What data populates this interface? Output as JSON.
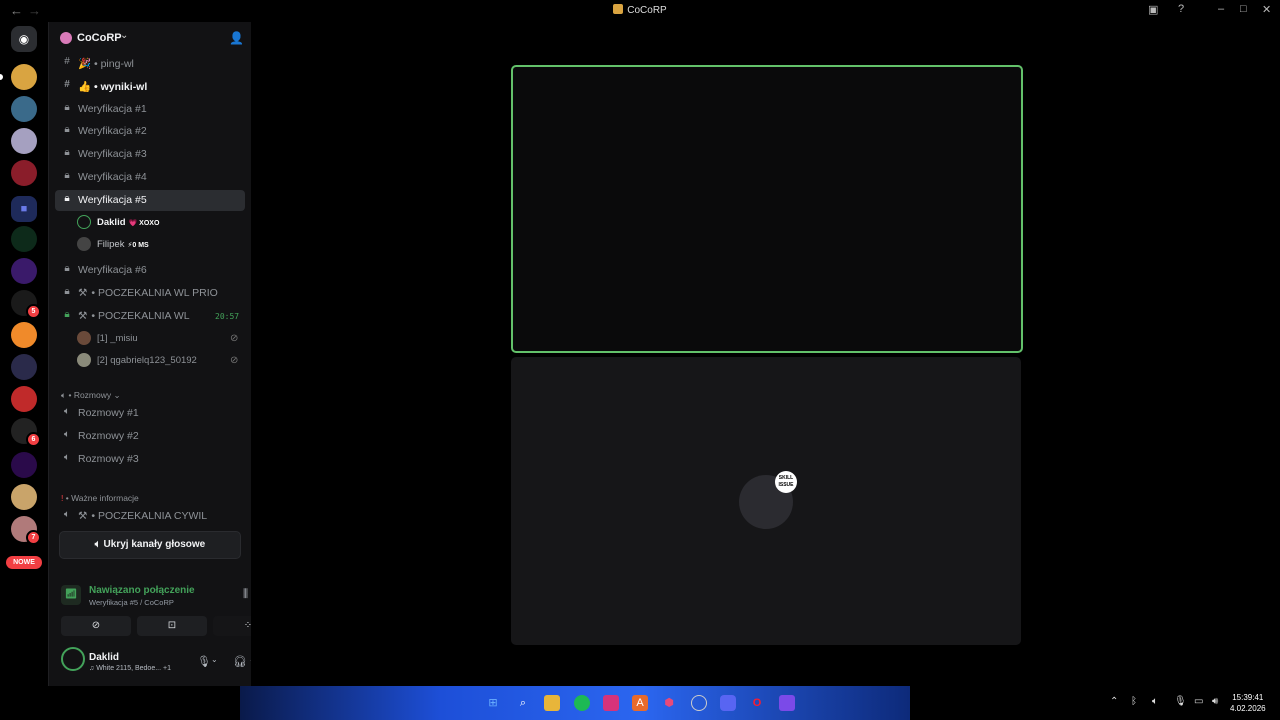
{
  "window": {
    "title": "CoCoRP"
  },
  "server": {
    "name": "CoCoRP"
  },
  "channels": [
    {
      "label": "ping-wl",
      "icon": "#",
      "prefix": "🎉 •"
    },
    {
      "label": "wyniki-wl",
      "icon": "#",
      "prefix": "👍 •"
    },
    {
      "label": "Weryfikacja #1",
      "icon": "lock"
    },
    {
      "label": "Weryfikacja #2",
      "icon": "lock"
    },
    {
      "label": "Weryfikacja #3",
      "icon": "lock"
    },
    {
      "label": "Weryfikacja #4",
      "icon": "lock"
    },
    {
      "label": "Weryfikacja #5",
      "icon": "lock"
    },
    {
      "label": "Weryfikacja #6",
      "icon": "lock"
    },
    {
      "label": "• POCZEKALNIA WL PRIO",
      "icon": "lock"
    },
    {
      "label": "• POCZEKALNIA WL",
      "icon": "lock",
      "time": "20:57"
    }
  ],
  "voice_users_w5": [
    {
      "name": "Daklid",
      "tag": "💗 XOXO"
    },
    {
      "name": "Filipek",
      "tag": "⚡0 MS"
    }
  ],
  "voice_users_wl": [
    {
      "name": "[1] _misiu"
    },
    {
      "name": "[2] qgabrielq123_50192"
    }
  ],
  "categories": {
    "rozmowy": "Rozmowy",
    "wazne": "Ważne informacje"
  },
  "rozmowy_channels": [
    "Rozmowy #1",
    "Rozmowy #2",
    "Rozmowy #3"
  ],
  "cywil_channel": "• POCZEKALNIA CYWIL",
  "hide_button": "Ukryj kanały głosowe",
  "voice_panel": {
    "status": "Nawiązano połączenie",
    "sub": "Weryfikacja #5 / CoCoRP"
  },
  "user_panel": {
    "name": "Daklid",
    "status": "♫ White 2115, Bedoe...",
    "extra": "+1"
  },
  "server_badges": [
    "5",
    "6",
    "7"
  ],
  "new_label": "NOWE",
  "tile2_sticker": "SKILL ISSUE",
  "clock": {
    "time": "15:39:41",
    "date": "4.02.2026"
  },
  "colors": {
    "accent_green": "#63c16a",
    "connected": "#43a25a",
    "badge": "#f23f43"
  }
}
